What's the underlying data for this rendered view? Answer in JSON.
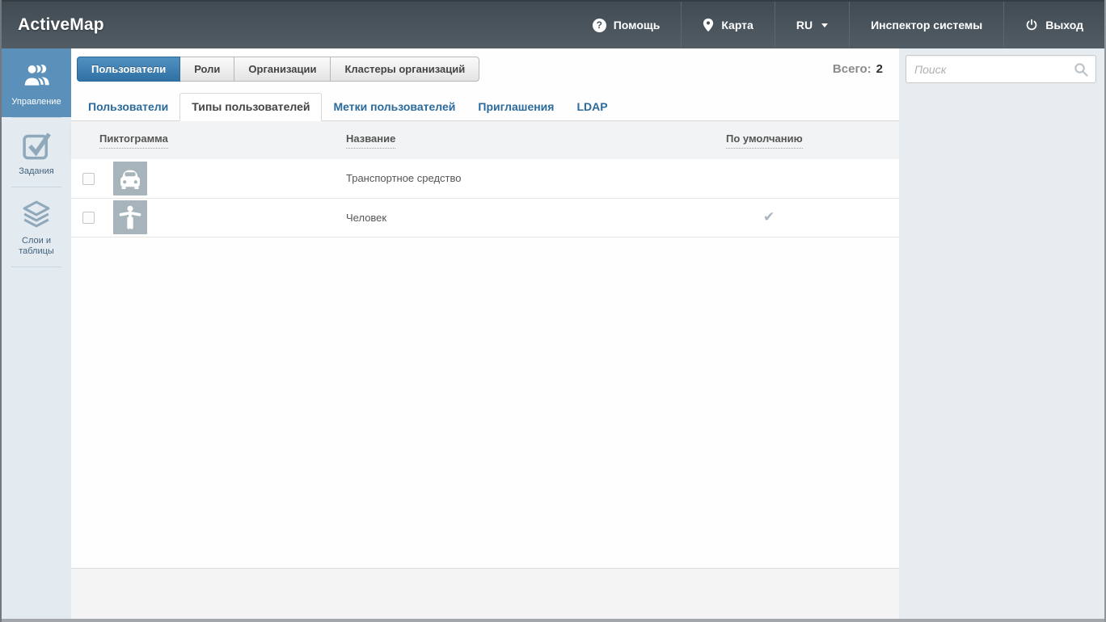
{
  "colors": {
    "accent_blue": "#3071a5",
    "sidebar_active_blue": "#5b90ba",
    "header_dark": "#49535b",
    "link_blue": "#2b6a9b",
    "muted_icon_gray": "#a7b4bc"
  },
  "header": {
    "app_title": "ActiveMap",
    "nav_items": [
      {
        "label": "Помощь",
        "icon": "help-icon"
      },
      {
        "label": "Карта",
        "icon": "map-pin-icon"
      },
      {
        "label": "RU",
        "icon": "caret-down-icon"
      },
      {
        "label": "Инспектор системы",
        "icon": "none"
      },
      {
        "label": "Выход",
        "icon": "power-icon"
      }
    ]
  },
  "sidebar": {
    "items": [
      {
        "label": "Управление",
        "icon": "users-icon",
        "active": true
      },
      {
        "label": "Задания",
        "icon": "task-check-icon",
        "active": false
      },
      {
        "label": "Слои и таблицы",
        "icon": "layers-icon",
        "active": false
      }
    ]
  },
  "main": {
    "tabs": [
      {
        "label": "Пользователи",
        "active": true
      },
      {
        "label": "Роли",
        "active": false
      },
      {
        "label": "Организации",
        "active": false
      },
      {
        "label": "Кластеры организаций",
        "active": false
      }
    ],
    "total_label": "Всего:",
    "total_value": "2",
    "sub_tabs": [
      {
        "label": "Пользователи",
        "active": false
      },
      {
        "label": "Типы пользователей",
        "active": true
      },
      {
        "label": "Метки пользователей",
        "active": false
      },
      {
        "label": "Приглашения",
        "active": false
      },
      {
        "label": "LDAP",
        "active": false
      }
    ],
    "table": {
      "columns": [
        "Пиктограмма",
        "Название",
        "По умолчанию"
      ],
      "rows": [
        {
          "icon": "vehicle-icon",
          "name": "Транспортное средство",
          "is_default": false
        },
        {
          "icon": "person-icon",
          "name": "Человек",
          "is_default": true
        }
      ]
    }
  },
  "search": {
    "placeholder": "Поиск"
  },
  "icons": {
    "default_check": "✔"
  }
}
